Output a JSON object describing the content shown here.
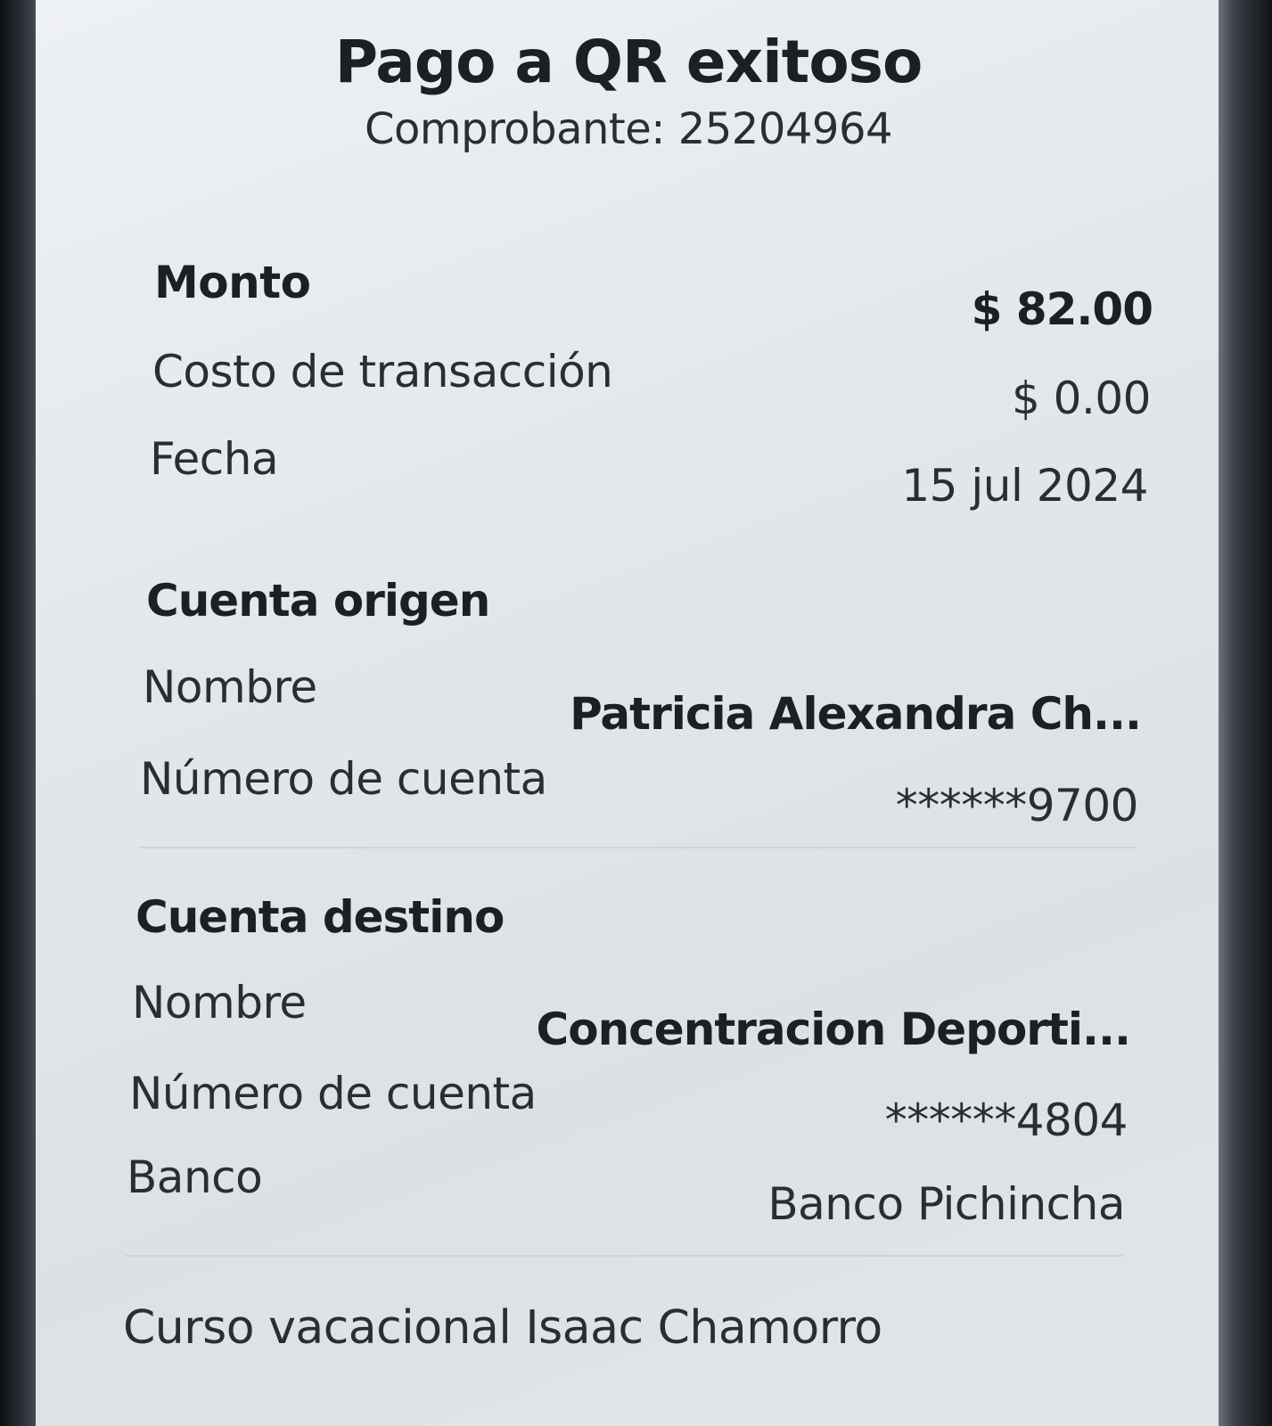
{
  "header": {
    "title": "Pago a QR exitoso",
    "receipt": "Comprobante: 25204964"
  },
  "summary": {
    "amount_label": "Monto",
    "amount_value": "$ 82.00",
    "fee_label": "Costo de transacción",
    "fee_value": "$ 0.00",
    "date_label": "Fecha",
    "date_value": "15 jul 2024"
  },
  "origin": {
    "section_title": "Cuenta origen",
    "name_label": "Nombre",
    "name_value": "Patricia Alexandra Ch...",
    "account_label": "Número de cuenta",
    "account_value": "******9700"
  },
  "destination": {
    "section_title": "Cuenta destino",
    "name_label": "Nombre",
    "name_value": "Concentracion Deporti...",
    "account_label": "Número de cuenta",
    "account_value": "******4804",
    "bank_label": "Banco",
    "bank_value": "Banco Pichincha"
  },
  "note": "Curso vacacional Isaac Chamorro"
}
